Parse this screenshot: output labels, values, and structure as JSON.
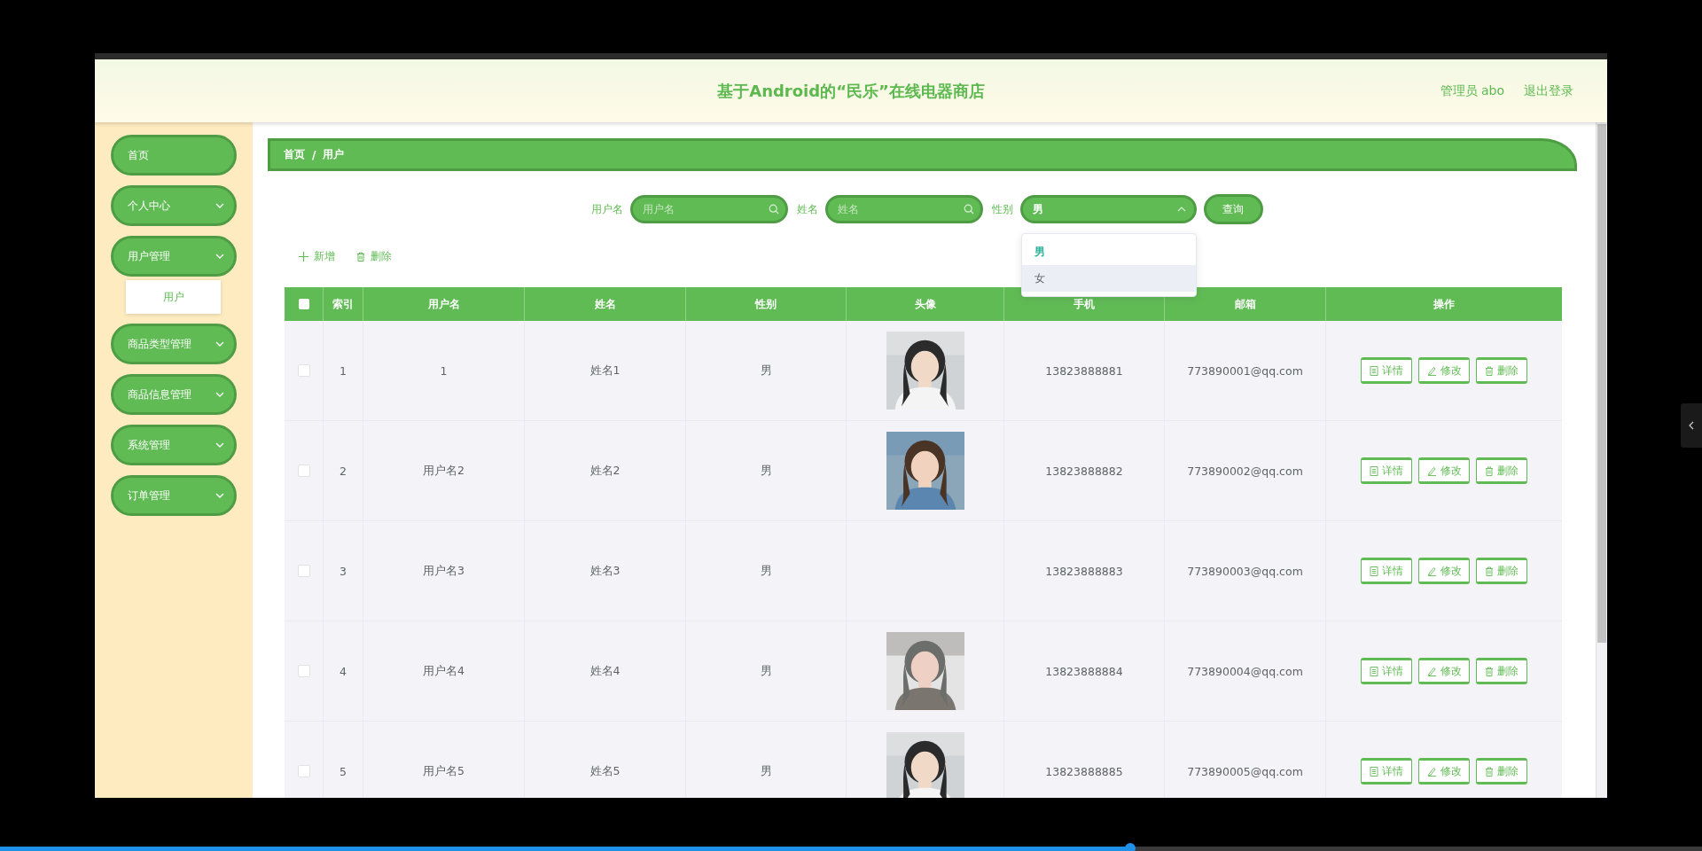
{
  "player": {
    "progress": {
      "level": 0.664
    }
  },
  "header": {
    "title": "基于Android的“民乐”在线电器商店",
    "user": "管理员 abo",
    "logout": "退出登录"
  },
  "sidebar": {
    "items": [
      {
        "label": "首页",
        "kind": "link"
      },
      {
        "label": "个人中心",
        "kind": "menu"
      },
      {
        "label": "用户管理",
        "kind": "menu",
        "children": [
          {
            "label": "用户"
          }
        ]
      },
      {
        "label": "商品类型管理",
        "kind": "menu"
      },
      {
        "label": "商品信息管理",
        "kind": "menu"
      },
      {
        "label": "系统管理",
        "kind": "menu"
      },
      {
        "label": "订单管理",
        "kind": "menu"
      }
    ]
  },
  "breadcrumb": {
    "items": [
      "首页",
      "用户"
    ],
    "separator": "/"
  },
  "search": {
    "fields": [
      {
        "label": "用户名",
        "placeholder": "用户名"
      },
      {
        "label": "姓名",
        "placeholder": "姓名"
      }
    ],
    "select": {
      "label": "性别",
      "value": "男",
      "expanded": true,
      "options": [
        {
          "label": "男",
          "selected": true,
          "hovered": false
        },
        {
          "label": "女",
          "selected": false,
          "hovered": true
        }
      ]
    },
    "button": "查询"
  },
  "toolbar": [
    {
      "kind": "add",
      "label": "新增"
    },
    {
      "kind": "delete",
      "label": "删除"
    }
  ],
  "table": {
    "all_checked": false,
    "columns": [
      "索引",
      "用户名",
      "姓名",
      "性别",
      "头像",
      "手机",
      "邮箱",
      "操作"
    ],
    "rows": [
      {
        "checked": false,
        "index": "1",
        "username": "1",
        "name": "姓名1",
        "gender": "男",
        "phone": "13823888881",
        "email": "773890001@qq.com",
        "actions": [
          {
            "kind": "detail",
            "label": "详情"
          },
          {
            "kind": "edit",
            "label": "修改"
          },
          {
            "kind": "delete",
            "label": "删除"
          }
        ]
      },
      {
        "checked": false,
        "index": "2",
        "username": "用户名2",
        "name": "姓名2",
        "gender": "男",
        "phone": "13823888882",
        "email": "773890002@qq.com",
        "actions": [
          {
            "kind": "detail",
            "label": "详情"
          },
          {
            "kind": "edit",
            "label": "修改"
          },
          {
            "kind": "delete",
            "label": "删除"
          }
        ]
      },
      {
        "checked": false,
        "index": "3",
        "username": "用户名3",
        "name": "姓名3",
        "gender": "男",
        "phone": "13823888883",
        "email": "773890003@qq.com",
        "actions": [
          {
            "kind": "detail",
            "label": "详情"
          },
          {
            "kind": "edit",
            "label": "修改"
          },
          {
            "kind": "delete",
            "label": "删除"
          }
        ]
      },
      {
        "checked": false,
        "index": "4",
        "username": "用户名4",
        "name": "姓名4",
        "gender": "男",
        "phone": "13823888884",
        "email": "773890004@qq.com",
        "actions": [
          {
            "kind": "detail",
            "label": "详情"
          },
          {
            "kind": "edit",
            "label": "修改"
          },
          {
            "kind": "delete",
            "label": "删除"
          }
        ]
      },
      {
        "checked": false,
        "index": "5",
        "username": "用户名5",
        "name": "姓名5",
        "gender": "男",
        "phone": "13823888885",
        "email": "773890005@qq.com",
        "actions": [
          {
            "kind": "detail",
            "label": "详情"
          },
          {
            "kind": "edit",
            "label": "修改"
          },
          {
            "kind": "delete",
            "label": "删除"
          }
        ]
      }
    ]
  }
}
